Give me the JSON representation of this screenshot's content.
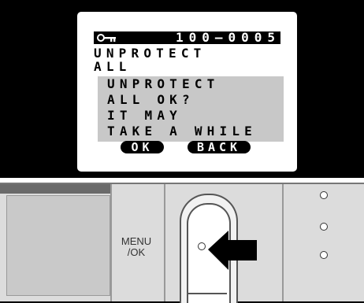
{
  "lcd": {
    "frame_number": "100—0005",
    "key_icon": "protect-key-icon",
    "menu_title_line1": "UNPROTECT",
    "menu_title_line2": "ALL",
    "dialog": [
      "UNPROTECT",
      "ALL OK?",
      "IT MAY",
      "TAKE A WHILE"
    ],
    "ok_label": "OK",
    "back_label": "BACK"
  },
  "camera": {
    "menu_ok_line1": "MENU",
    "menu_ok_line2": "/OK"
  },
  "colors": {
    "lcd_bg": "#ffffff",
    "dialog_bg": "#c8c8c8",
    "body_grey": "#dcdcdc"
  }
}
